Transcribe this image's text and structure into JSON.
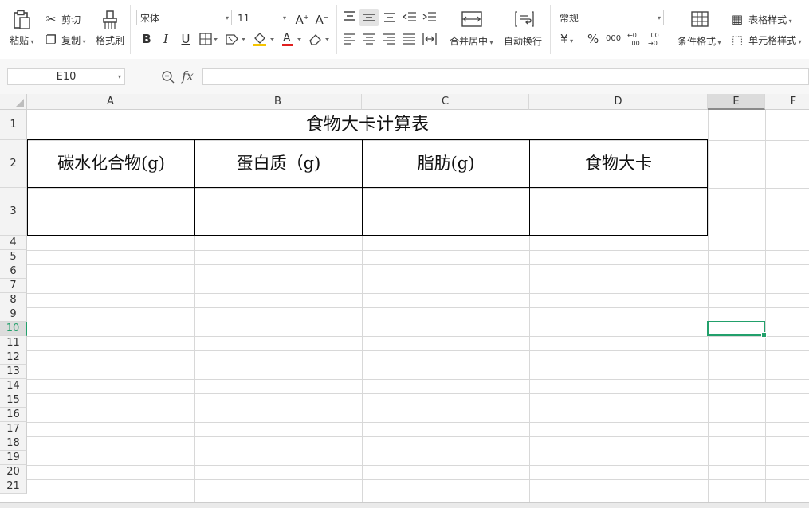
{
  "ribbon": {
    "paste_label": "粘贴",
    "cut_label": "剪切",
    "copy_label": "复制",
    "format_painter_label": "格式刷",
    "font_name": "宋体",
    "font_size": "11",
    "merge_center_label": "合并居中",
    "wrap_text_label": "自动换行",
    "number_format": "常规",
    "conditional_format_label": "条件格式",
    "table_style_label": "表格样式",
    "cell_style_label": "单元格样式",
    "currency_symbol": "¥",
    "percent_symbol": "%",
    "thousands_symbol": "000"
  },
  "formula_bar": {
    "name_box": "E10",
    "fx_label": "fx",
    "value": ""
  },
  "sheet": {
    "columns": [
      "A",
      "B",
      "C",
      "D",
      "E",
      "F"
    ],
    "rows": [
      "1",
      "2",
      "3",
      "4",
      "5",
      "6",
      "7",
      "8",
      "9",
      "10",
      "11",
      "12",
      "13",
      "14",
      "15",
      "16",
      "17",
      "18",
      "19",
      "20",
      "21"
    ],
    "selected_cell": "E10",
    "title": "食物大卡计算表",
    "headers": [
      "碳水化合物(g)",
      "蛋白质（g)",
      "脂肪(g)",
      "食物大卡"
    ]
  },
  "colors": {
    "selection": "#22a06b",
    "grid_line": "#d8d8d8",
    "header_bg": "#f3f3f3"
  }
}
